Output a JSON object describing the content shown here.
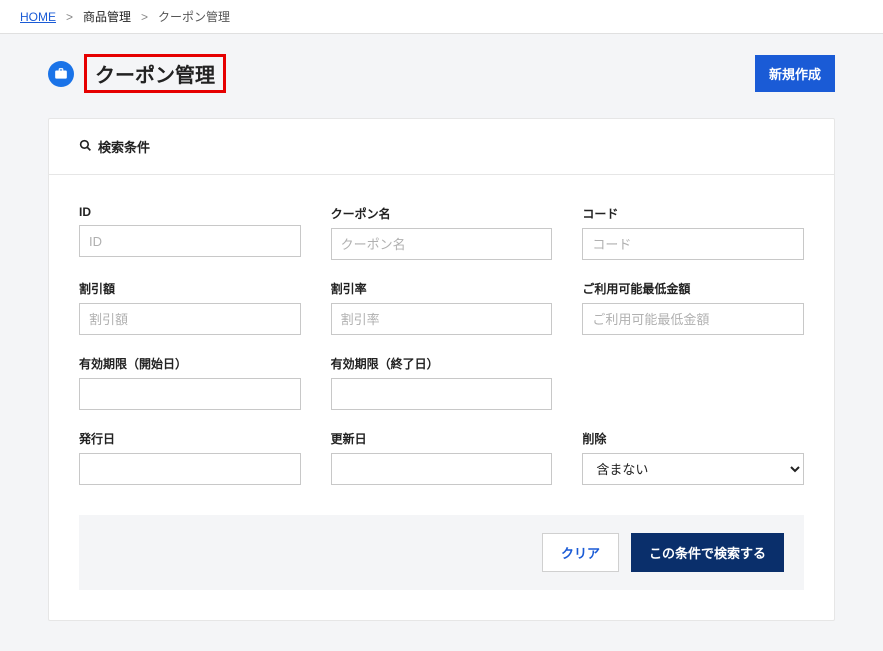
{
  "breadcrumb": {
    "home": "HOME",
    "item1": "商品管理",
    "current": "クーポン管理"
  },
  "header": {
    "title": "クーポン管理",
    "create_button": "新規作成"
  },
  "search_panel": {
    "title": "検索条件",
    "fields": {
      "id": {
        "label": "ID",
        "placeholder": "ID"
      },
      "name": {
        "label": "クーポン名",
        "placeholder": "クーポン名"
      },
      "code": {
        "label": "コード",
        "placeholder": "コード"
      },
      "discount_amount": {
        "label": "割引額",
        "placeholder": "割引額"
      },
      "discount_rate": {
        "label": "割引率",
        "placeholder": "割引率"
      },
      "min_usable_amount": {
        "label": "ご利用可能最低金額",
        "placeholder": "ご利用可能最低金額"
      },
      "valid_from": {
        "label": "有効期限（開始日）"
      },
      "valid_to": {
        "label": "有効期限（終了日）"
      },
      "issued_at": {
        "label": "発行日"
      },
      "updated_at": {
        "label": "更新日"
      },
      "deleted": {
        "label": "削除",
        "selected": "含まない"
      }
    },
    "actions": {
      "clear": "クリア",
      "search": "この条件で検索する"
    }
  }
}
